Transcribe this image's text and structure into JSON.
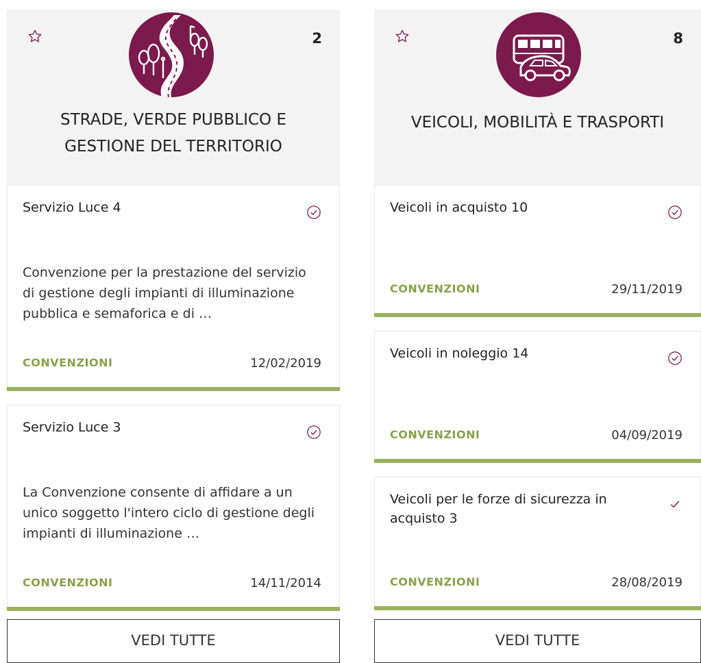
{
  "categories": [
    {
      "title_line1": "STRADE, VERDE PUBBLICO E",
      "title_line2": "GESTIONE DEL TERRITORIO",
      "count": "2",
      "icon": "road-trees-icon",
      "cards": [
        {
          "title": "Servizio Luce 4",
          "description": "Convenzione per la prestazione del servizio di gestione degli impianti di illuminazione pubblica e semaforica e di …",
          "tag": "CONVENZIONI",
          "date": "12/02/2019",
          "status_icon": "check-circle-icon"
        },
        {
          "title": "Servizio Luce 3",
          "description": "La Convenzione consente di affidare a un unico soggetto l'intero ciclo di gestione degli impianti di illuminazione …",
          "tag": "CONVENZIONI",
          "date": "14/11/2014",
          "status_icon": "check-circle-icon"
        }
      ],
      "view_all": "VEDI TUTTE"
    },
    {
      "title_line1": "VEICOLI, MOBILITÀ E TRASPORTI",
      "title_line2": "",
      "count": "8",
      "icon": "bus-car-icon",
      "cards": [
        {
          "title": "Veicoli in acquisto 10",
          "description": "",
          "tag": "CONVENZIONI",
          "date": "29/11/2019",
          "status_icon": "check-circle-icon"
        },
        {
          "title": "Veicoli in noleggio 14",
          "description": "",
          "tag": "CONVENZIONI",
          "date": "04/09/2019",
          "status_icon": "check-circle-icon"
        },
        {
          "title": "Veicoli per le forze di sicurezza in acquisto 3",
          "description": "",
          "tag": "CONVENZIONI",
          "date": "28/08/2019",
          "status_icon": "check-icon"
        }
      ],
      "view_all": "VEDI TUTTE"
    }
  ],
  "colors": {
    "accent": "#7c1a4b",
    "tag_green": "#8aa04b",
    "bar_green": "#9bb05d",
    "header_bg": "#f3f3f3"
  }
}
